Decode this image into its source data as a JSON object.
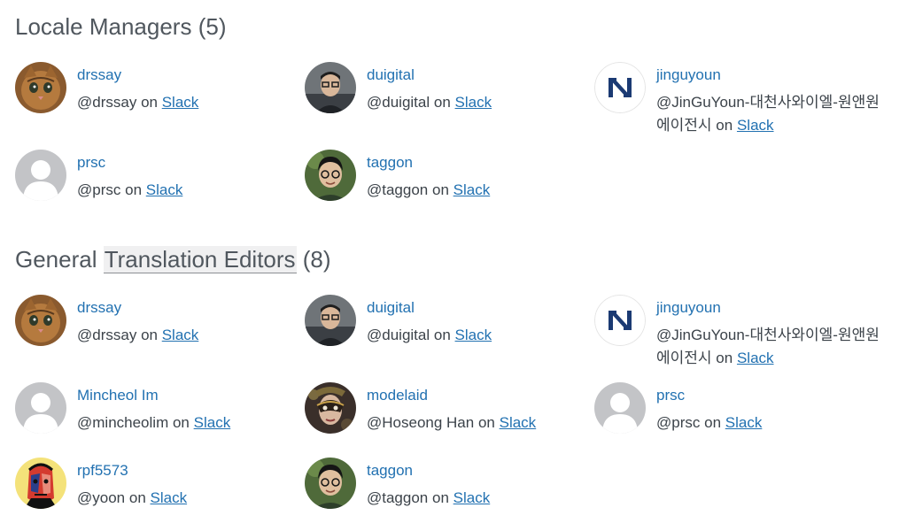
{
  "locale_managers": {
    "title": "Locale Managers",
    "count": "(5)",
    "members": [
      {
        "username": "drssay",
        "handle": "@drssay",
        "on": "on",
        "slack": "Slack",
        "avatar_icon": "cat-photo-avatar"
      },
      {
        "username": "duigital",
        "handle": "@duigital",
        "on": "on",
        "slack": "Slack",
        "avatar_icon": "person-glasses-photo-avatar"
      },
      {
        "username": "jinguyoun",
        "handle": "@JinGuYoun-대천사와이엘-원앤원에이전시",
        "on": "on",
        "slack": "Slack",
        "avatar_icon": "n-logo-avatar"
      },
      {
        "username": "prsc",
        "handle": "@prsc",
        "on": "on",
        "slack": "Slack",
        "avatar_icon": "default-person-avatar"
      },
      {
        "username": "taggon",
        "handle": "@taggon",
        "on": "on",
        "slack": "Slack",
        "avatar_icon": "person-glasses-photo-avatar"
      }
    ]
  },
  "translation_editors": {
    "title_prefix": "General",
    "title_highlight": "Translation Editors",
    "count": "(8)",
    "members": [
      {
        "username": "drssay",
        "handle": "@drssay",
        "on": "on",
        "slack": "Slack",
        "avatar_icon": "cat-photo-avatar"
      },
      {
        "username": "duigital",
        "handle": "@duigital",
        "on": "on",
        "slack": "Slack",
        "avatar_icon": "person-glasses-photo-avatar"
      },
      {
        "username": "jinguyoun",
        "handle": "@JinGuYoun-대천사와이엘-원앤원에이전시",
        "on": "on",
        "slack": "Slack",
        "avatar_icon": "n-logo-avatar"
      },
      {
        "username": "Mincheol Im",
        "handle": "@mincheolim",
        "on": "on",
        "slack": "Slack",
        "avatar_icon": "default-person-avatar"
      },
      {
        "username": "modelaid",
        "handle": "@Hoseong Han",
        "on": "on",
        "slack": "Slack",
        "avatar_icon": "masquerade-mask-avatar"
      },
      {
        "username": "prsc",
        "handle": "@prsc",
        "on": "on",
        "slack": "Slack",
        "avatar_icon": "default-person-avatar"
      },
      {
        "username": "rpf5573",
        "handle": "@yoon",
        "on": "on",
        "slack": "Slack",
        "avatar_icon": "illustrated-face-avatar"
      },
      {
        "username": "taggon",
        "handle": "@taggon",
        "on": "on",
        "slack": "Slack",
        "avatar_icon": "person-glasses-photo-avatar"
      }
    ]
  },
  "colors": {
    "link": "#2271b1",
    "heading": "#50575e",
    "text": "#3c434a",
    "default_avatar_bg": "#c3c4c7"
  }
}
